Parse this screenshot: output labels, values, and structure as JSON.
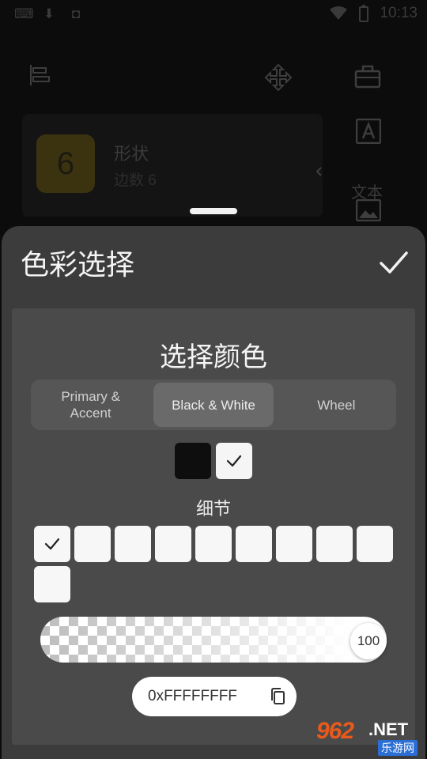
{
  "status_bar": {
    "time": "10:13"
  },
  "background_app": {
    "badge_number": "6",
    "item_title": "形状",
    "item_subtitle": "边数 6",
    "text_tool_label": "文本"
  },
  "sheet": {
    "title": "色彩选择",
    "panel_title": "选择颜色",
    "tabs": [
      {
        "label": "Primary &\nAccent",
        "active": false
      },
      {
        "label": "Black & White",
        "active": true
      },
      {
        "label": "Wheel",
        "active": false
      }
    ],
    "detail_label": "细节",
    "alpha_value": "100",
    "hex_value": "0xFFFFFFFF"
  },
  "colors": {
    "sheet_bg": "#3c3c3c",
    "panel_bg": "#4a4a4a",
    "swatch_black": "#0e0e0e",
    "swatch_white": "#f5f5f5"
  },
  "watermark": {
    "logo": "962",
    "logo_suffix": ".NET",
    "sub": "乐游网"
  }
}
